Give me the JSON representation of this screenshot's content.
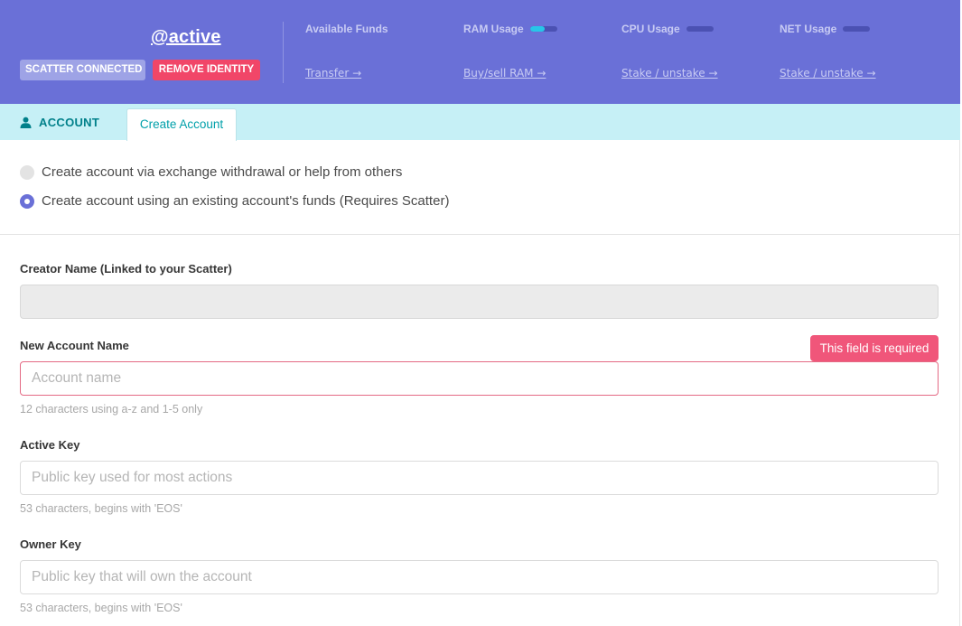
{
  "header": {
    "identity_name": "@active",
    "scatter_status": "SCATTER CONNECTED",
    "remove_identity": "REMOVE IDENTITY",
    "stats": [
      {
        "label": "Available Funds",
        "link": "Transfer →"
      },
      {
        "label": "RAM Usage",
        "link": "Buy/sell RAM →",
        "usage_fraction": 0.55
      },
      {
        "label": "CPU Usage",
        "link": "Stake / unstake →",
        "usage_fraction": 0
      },
      {
        "label": "NET Usage",
        "link": "Stake / unstake →",
        "usage_fraction": 0
      }
    ],
    "colors": {
      "background": "#6a70d7",
      "remove": "#f14668",
      "usage_fill": "#27c6e8"
    }
  },
  "tabs": {
    "account_label": "ACCOUNT",
    "create_label": "Create Account"
  },
  "options": {
    "option_exchange": "Create account via exchange withdrawal or help from others",
    "option_existing": "Create account using an existing account's funds (Requires Scatter)",
    "selected": "option_existing"
  },
  "form": {
    "creator": {
      "label": "Creator Name (Linked to your Scatter)",
      "value": ""
    },
    "new_account": {
      "label": "New Account Name",
      "placeholder": "Account name",
      "help": "12 characters using a-z and 1-5 only",
      "error": "This field is required"
    },
    "active_key": {
      "label": "Active Key",
      "placeholder": "Public key used for most actions",
      "help": "53 characters, begins with 'EOS'"
    },
    "owner_key": {
      "label": "Owner Key",
      "placeholder": "Public key that will own the account",
      "help": "53 characters, begins with 'EOS'"
    }
  }
}
